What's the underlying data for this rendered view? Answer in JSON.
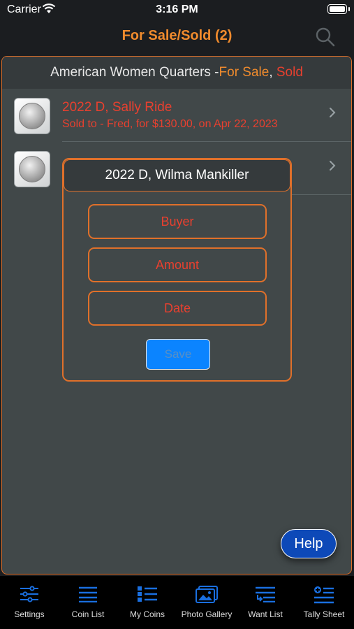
{
  "status_bar": {
    "carrier": "Carrier",
    "time": "3:16 PM"
  },
  "nav": {
    "title": "For Sale/Sold (2)",
    "search_icon": "search-icon"
  },
  "section": {
    "title_prefix": "American Women Quarters - ",
    "for_sale": "For Sale",
    "comma": ",",
    "sold": " Sold"
  },
  "rows": [
    {
      "title": "2022 D, Sally Ride",
      "subtitle": "Sold to - Fred, for $130.00, on Apr 22, 2023"
    },
    {
      "title": "2022 D, Wilma Mankiller",
      "subtitle": ""
    }
  ],
  "modal": {
    "title": "2022 D, Wilma Mankiller",
    "buyer_placeholder": "Buyer",
    "amount_placeholder": "Amount",
    "date_placeholder": "Date",
    "save_label": "Save"
  },
  "help_label": "Help",
  "tabs": [
    {
      "label": "Settings",
      "icon": "sliders-icon"
    },
    {
      "label": "Coin List",
      "icon": "list-icon"
    },
    {
      "label": "My Coins",
      "icon": "bullet-list-icon"
    },
    {
      "label": "Photo Gallery",
      "icon": "photo-gallery-icon"
    },
    {
      "label": "Want List",
      "icon": "want-list-icon"
    },
    {
      "label": "Tally Sheet",
      "icon": "tally-sheet-icon"
    }
  ],
  "colors": {
    "accent": "#f08b2d",
    "sold_red": "#e8402f",
    "tab_icon": "#1a6fe0",
    "help_blue": "#0d49b8"
  }
}
